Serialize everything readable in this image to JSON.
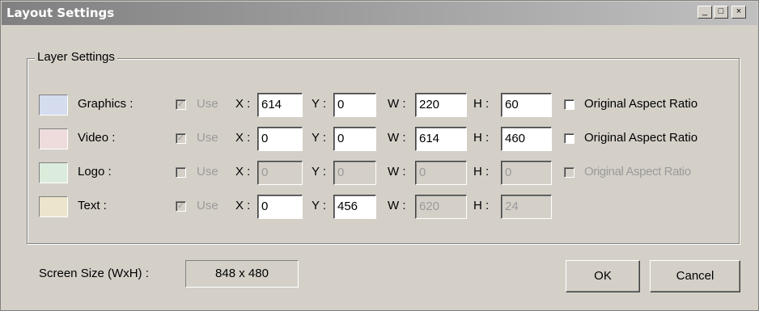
{
  "window": {
    "title": "Layout Settings"
  },
  "titlebar_buttons": {
    "minimize": "_",
    "maximize": "□",
    "close": "×"
  },
  "group": {
    "label": "Layer Settings"
  },
  "labels": {
    "use": "Use",
    "x": "X :",
    "y": "Y :",
    "w": "W :",
    "h": "H :",
    "aspect": "Original Aspect Ratio"
  },
  "layers": [
    {
      "name": "Graphics :",
      "color": "#d4dcee",
      "use_checked": true,
      "use_enabled": false,
      "x": "614",
      "y": "0",
      "w": "220",
      "h": "60",
      "x_enabled": true,
      "y_enabled": true,
      "w_enabled": true,
      "h_enabled": true,
      "aspect_visible": true,
      "aspect_checked": false,
      "aspect_enabled": true
    },
    {
      "name": "Video :",
      "color": "#eedcdc",
      "use_checked": true,
      "use_enabled": false,
      "x": "0",
      "y": "0",
      "w": "614",
      "h": "460",
      "x_enabled": true,
      "y_enabled": true,
      "w_enabled": true,
      "h_enabled": true,
      "aspect_visible": true,
      "aspect_checked": false,
      "aspect_enabled": true
    },
    {
      "name": "Logo :",
      "color": "#dcecdc",
      "use_checked": false,
      "use_enabled": false,
      "x": "0",
      "y": "0",
      "w": "0",
      "h": "0",
      "x_enabled": false,
      "y_enabled": false,
      "w_enabled": false,
      "h_enabled": false,
      "aspect_visible": true,
      "aspect_checked": false,
      "aspect_enabled": false
    },
    {
      "name": "Text :",
      "color": "#ece4cc",
      "use_checked": true,
      "use_enabled": false,
      "x": "0",
      "y": "456",
      "w": "620",
      "h": "24",
      "x_enabled": true,
      "y_enabled": true,
      "w_enabled": false,
      "h_enabled": false,
      "aspect_visible": false,
      "aspect_checked": false,
      "aspect_enabled": false
    }
  ],
  "screen_size": {
    "label": "Screen Size (WxH) :",
    "value": "848 x 480"
  },
  "buttons": {
    "ok": "OK",
    "cancel": "Cancel"
  }
}
